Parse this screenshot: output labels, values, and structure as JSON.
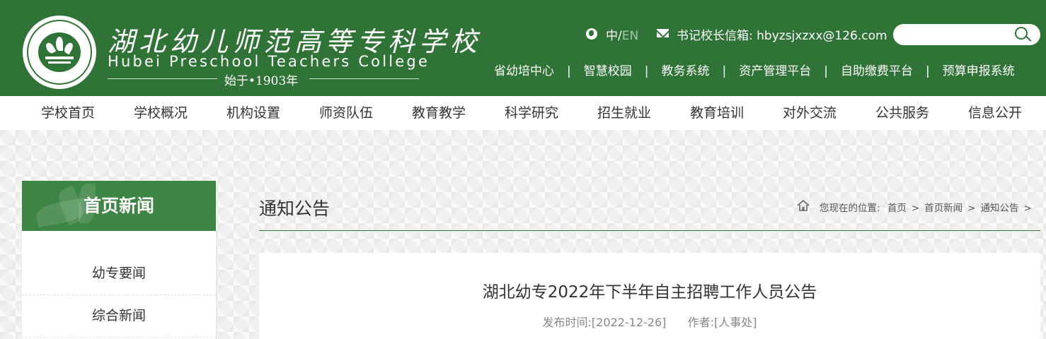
{
  "header": {
    "brand_cn": "湖北幼儿师范高等专科学校",
    "brand_en": "Hubei Preschool Teachers College",
    "since": "始于•1903年",
    "lang_zh": "中",
    "lang_sep": "/",
    "lang_en": "EN",
    "email_label": "书记校长信箱:",
    "email": "hbyzsjxzxx@126.com",
    "search_placeholder": "",
    "quick_links": [
      "省幼培中心",
      "智慧校园",
      "教务系统",
      "资产管理平台",
      "自助缴费平台",
      "预算申报系统"
    ],
    "quick_sep": "|"
  },
  "nav": {
    "items": [
      "学校首页",
      "学校概况",
      "机构设置",
      "师资队伍",
      "教育教学",
      "科学研究",
      "招生就业",
      "教育培训",
      "对外交流",
      "公共服务",
      "信息公开"
    ]
  },
  "sidebar": {
    "title": "首页新闻",
    "items": [
      "幼专要闻",
      "综合新闻"
    ]
  },
  "main": {
    "section_title": "通知公告",
    "breadcrumb_label": "您现在的位置:",
    "breadcrumb": [
      "首页",
      "首页新闻",
      "通知公告"
    ],
    "arrow": ">",
    "article_title": "湖北幼专2022年下半年自主招聘工作人员公告",
    "publish_label": "发布时间:",
    "publish_date": "[2022-12-26]",
    "author_label": "作者:",
    "author": "[人事处]"
  },
  "colors": {
    "brand_green": "#2f7436",
    "sidebar_green": "#3d8544"
  }
}
